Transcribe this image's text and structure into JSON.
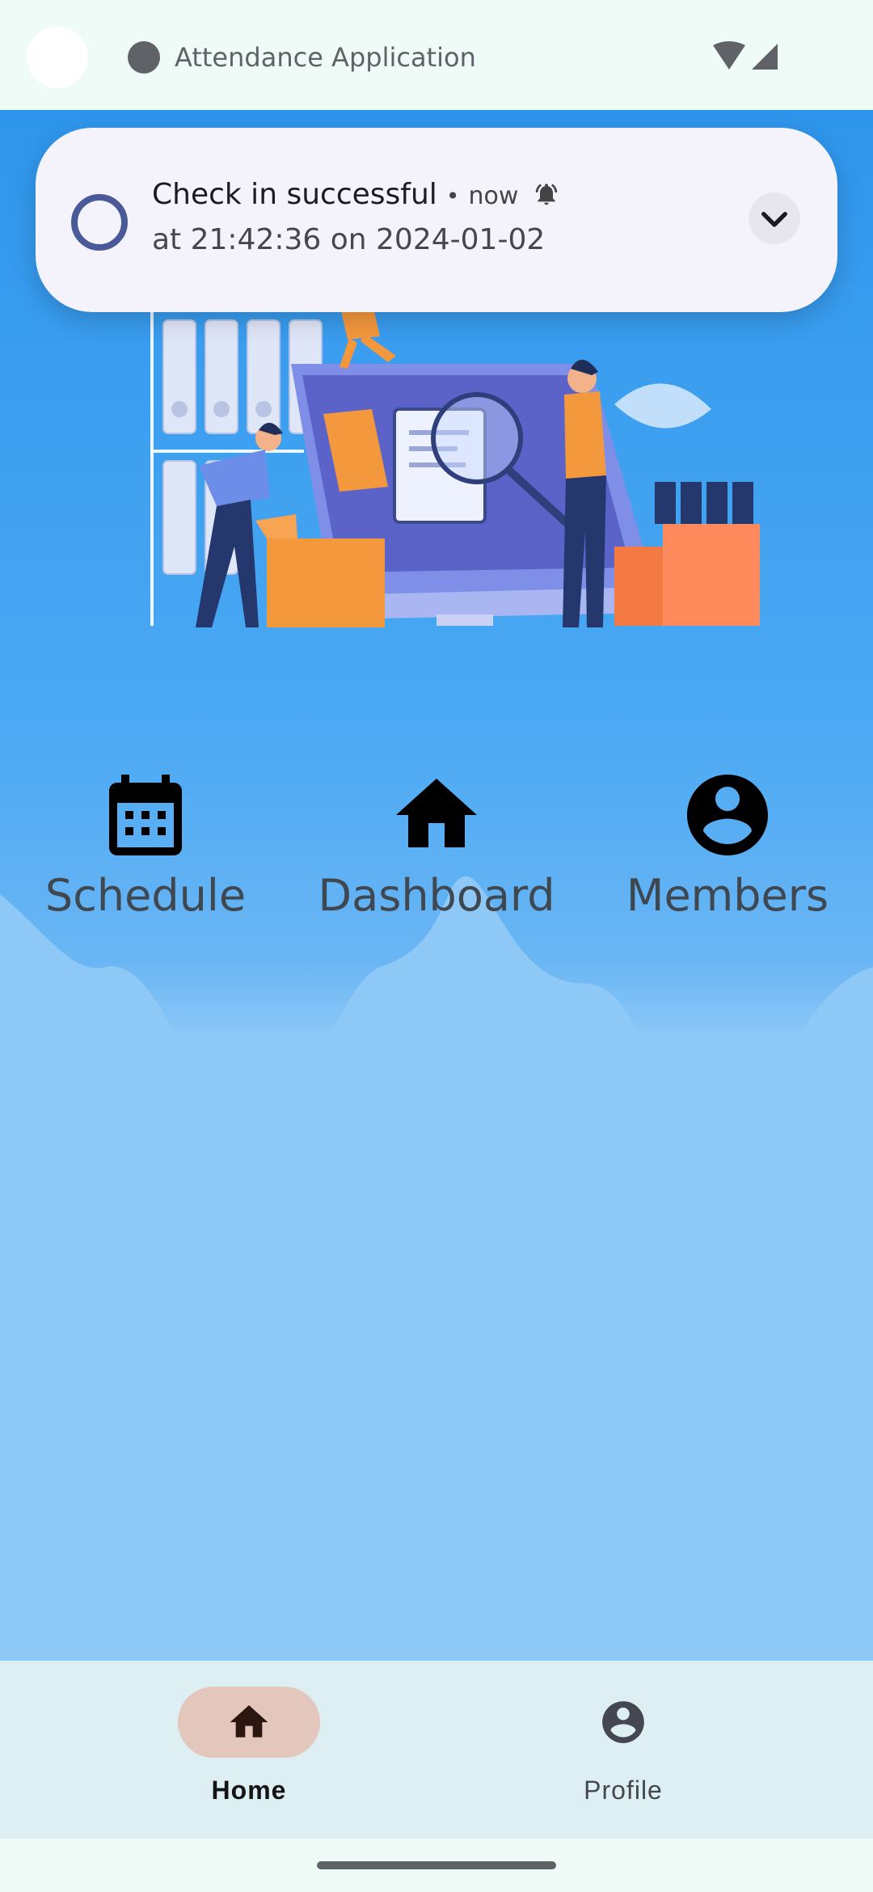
{
  "status_bar": {
    "title": "Attendance Application"
  },
  "notification": {
    "title": "Check in successful",
    "separator": "•",
    "time": "now",
    "body": "at 21:42:36 on 2024-01-02"
  },
  "menu": {
    "items": [
      {
        "label": "Schedule",
        "icon": "calendar-icon"
      },
      {
        "label": "Dashboard",
        "icon": "home-icon"
      },
      {
        "label": "Members",
        "icon": "account-circle-icon"
      }
    ]
  },
  "bottom_nav": {
    "items": [
      {
        "label": "Home",
        "icon": "home-icon",
        "active": true
      },
      {
        "label": "Profile",
        "icon": "account-circle-icon",
        "active": false
      }
    ]
  },
  "colors": {
    "primary_blue": "#2e95ec",
    "light_blue": "#8ec8f7",
    "nav_background": "#ddeff2",
    "active_pill": "#e3c7bd",
    "notification_ring": "#4a5a98"
  }
}
